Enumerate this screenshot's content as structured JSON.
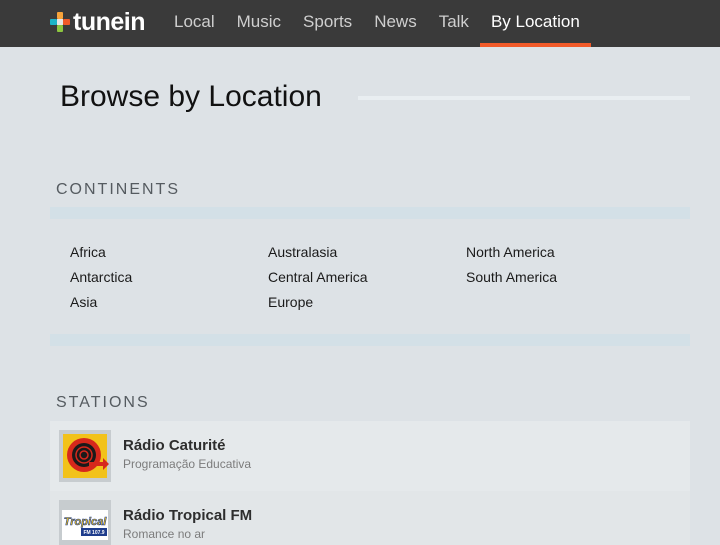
{
  "brand": {
    "logo_text": "tunein"
  },
  "nav": {
    "items": [
      {
        "label": "Local"
      },
      {
        "label": "Music"
      },
      {
        "label": "Sports"
      },
      {
        "label": "News"
      },
      {
        "label": "Talk"
      },
      {
        "label": "By Location",
        "active": true
      }
    ]
  },
  "page": {
    "title": "Browse by Location"
  },
  "continents": {
    "heading": "Continents",
    "items": [
      "Africa",
      "Antarctica",
      "Asia",
      "Australasia",
      "Central America",
      "Europe",
      "North America",
      "South America"
    ]
  },
  "stations": {
    "heading": "Stations",
    "items": [
      {
        "name": "Rádio Caturité",
        "description": "Programação Educativa"
      },
      {
        "name": "Rádio Tropical FM",
        "description": "Romance no ar",
        "logo_text": "Tropical",
        "logo_subtext": "FM 107.9"
      }
    ]
  },
  "colors": {
    "accent": "#f15a29",
    "topbar": "#3a3a3a",
    "page_bg": "#dde2e6"
  }
}
